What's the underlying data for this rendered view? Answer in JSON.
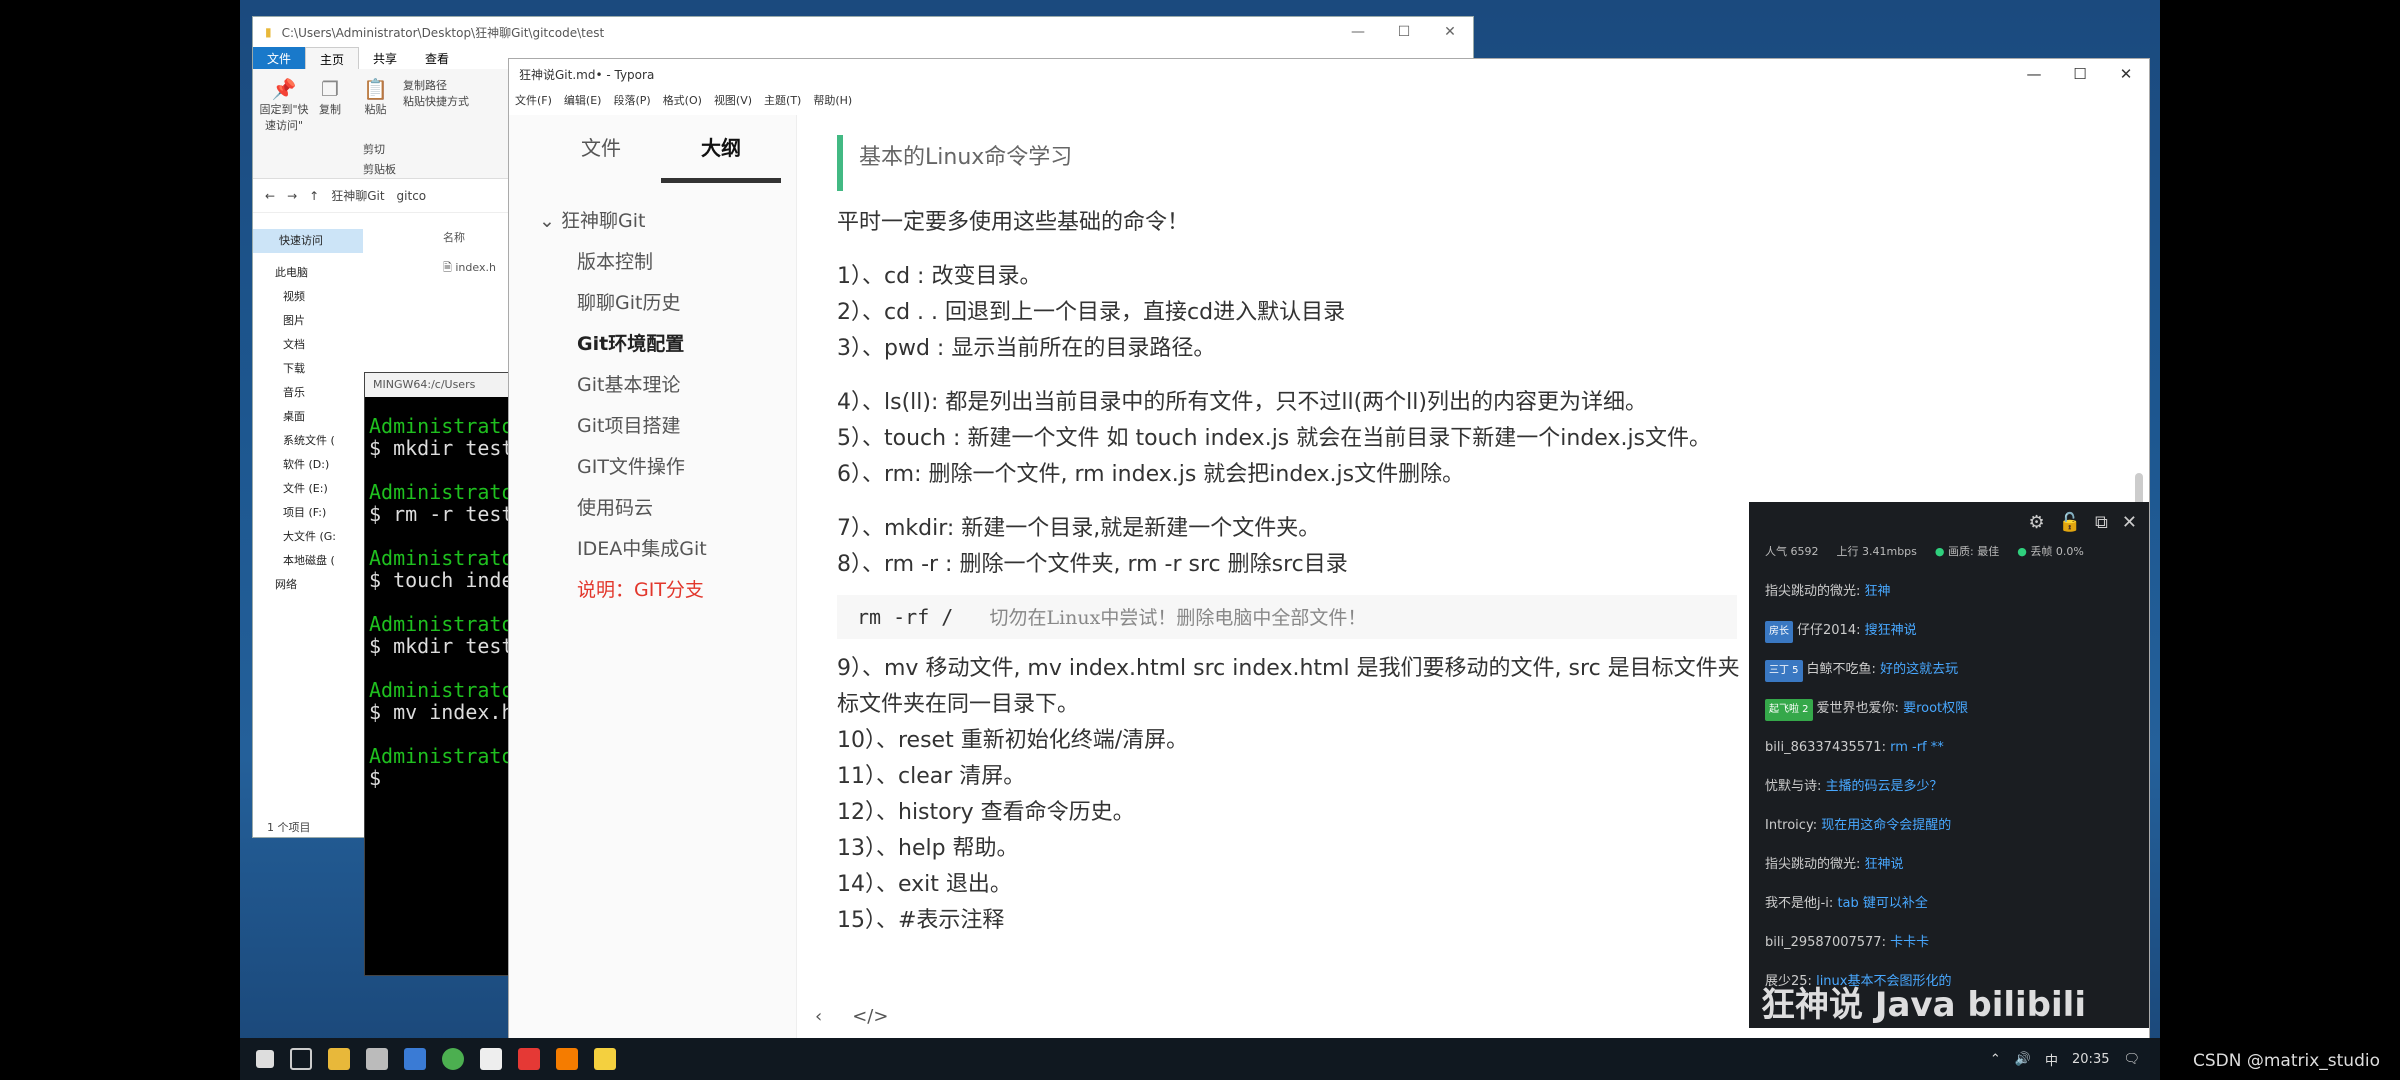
{
  "explorer": {
    "title_path": "C:\\Users\\Administrator\\Desktop\\狂神聊Git\\gitcode\\test",
    "ribbon_tabs": [
      "文件",
      "主页",
      "共享",
      "查看"
    ],
    "ribbon": {
      "pin": "固定到\"快速访问\"",
      "copy": "复制",
      "paste": "粘贴",
      "copy_path": "复制路径",
      "paste_shortcut": "粘贴快捷方式",
      "cut": "剪切",
      "clipboard": "剪贴板"
    },
    "address": [
      "狂神聊Git",
      "gitco"
    ],
    "nav": {
      "quick_access": "快速访问",
      "this_pc": "此电脑",
      "items": [
        "视频",
        "图片",
        "文档",
        "下载",
        "音乐",
        "桌面",
        "系统文件 (",
        "软件 (D:)",
        "文件 (E:)",
        "项目 (F:)",
        "大文件 (G:",
        "本地磁盘 ("
      ],
      "network": "网络"
    },
    "column_name": "名称",
    "file": "index.h",
    "status": "1 个项目"
  },
  "terminal": {
    "title": "MINGW64:/c/Users",
    "entries": [
      {
        "prompt": "Administrato",
        "cmd": "$ mkdir test"
      },
      {
        "prompt": "Administrato",
        "cmd": "$ rm -r test"
      },
      {
        "prompt": "Administrato",
        "cmd": "$ touch inde"
      },
      {
        "prompt": "Administrato",
        "cmd": "$ mkdir test"
      },
      {
        "prompt": "Administrato",
        "cmd": "$ mv index.h"
      },
      {
        "prompt": "Administrato",
        "cmd": "$"
      }
    ]
  },
  "typora": {
    "title": "狂神说Git.md• - Typora",
    "menu": [
      "文件(F)",
      "编辑(E)",
      "段落(P)",
      "格式(O)",
      "视图(V)",
      "主题(T)",
      "帮助(H)"
    ],
    "tabs": {
      "files": "文件",
      "outline": "大纲"
    },
    "outline": {
      "root": "狂神聊Git",
      "items": [
        {
          "label": "版本控制",
          "style": ""
        },
        {
          "label": "聊聊Git历史",
          "style": ""
        },
        {
          "label": "Git环境配置",
          "style": "bold"
        },
        {
          "label": "Git基本理论",
          "style": ""
        },
        {
          "label": "Git项目搭建",
          "style": ""
        },
        {
          "label": "GIT文件操作",
          "style": ""
        },
        {
          "label": "使用码云",
          "style": ""
        },
        {
          "label": "IDEA中集成Git",
          "style": ""
        },
        {
          "label": "说明：GIT分支",
          "style": "red"
        }
      ]
    },
    "heading": "基本的Linux命令学习",
    "intro": "平时一定要多使用这些基础的命令！",
    "group1": [
      "1）、cd : 改变目录。",
      "2）、cd . . 回退到上一个目录，直接cd进入默认目录",
      "3）、pwd : 显示当前所在的目录路径。"
    ],
    "group2": [
      "4）、ls(ll):  都是列出当前目录中的所有文件，只不过ll(两个ll)列出的内容更为详细。",
      "5）、touch : 新建一个文件 如 touch index.js 就会在当前目录下新建一个index.js文件。",
      "6）、rm:  删除一个文件, rm index.js 就会把index.js文件删除。"
    ],
    "group3": [
      "7）、mkdir:  新建一个目录,就是新建一个文件夹。",
      "8）、rm -r :  删除一个文件夹, rm -r src 删除src目录"
    ],
    "code": {
      "cmd": "rm -rf /",
      "comment": "切勿在Linux中尝试！删除电脑中全部文件！"
    },
    "group4": [
      "9）、mv 移动文件, mv index.html src index.html 是我们要移动的文件, src 是目标文件夹",
      "标文件夹在同一目录下。",
      "10）、reset 重新初始化终端/清屏。",
      "11）、clear 清屏。",
      "12）、history 查看命令历史。",
      "13）、help 帮助。",
      "14）、exit 退出。",
      "15）、#表示注释"
    ]
  },
  "chat": {
    "stats": {
      "popularity": "人气  6592",
      "upload": "上行  3.41mbps",
      "quality": "画质: 最佳",
      "drop": "丢帧 0.0%"
    },
    "messages": [
      {
        "badge": "",
        "user": "指尖跳动的微光:",
        "text": "狂神"
      },
      {
        "badge": "房长",
        "user": "仔仔2014:",
        "text": "搜狂神说"
      },
      {
        "badge": "三丁 5",
        "user": "白鲸不吃鱼:",
        "text": "好的这就去玩"
      },
      {
        "badge": "起飞啦 2",
        "user": "爱世界也爱你:",
        "text": "要root权限"
      },
      {
        "badge": "",
        "user": "bili_86337435571:",
        "text": "rm -rf **"
      },
      {
        "badge": "",
        "user": "忧默与诗:",
        "text": "主播的码云是多少？"
      },
      {
        "badge": "",
        "user": "Introicy:",
        "text": "现在用这命令会提醒的"
      },
      {
        "badge": "",
        "user": "指尖跳动的微光:",
        "text": "狂神说"
      },
      {
        "badge": "",
        "user": "我不是他j-i:",
        "text": "tab 键可以补全"
      },
      {
        "badge": "",
        "user": "bili_29587007577:",
        "text": "卡卡卡"
      },
      {
        "badge": "",
        "user": "展少25:",
        "text": "linux基本不会图形化的"
      }
    ],
    "watermark": "狂神说 Java   bilibili"
  },
  "taskbar": {
    "time": "20:35",
    "ime": "中"
  },
  "credit": "CSDN @matrix_studio"
}
